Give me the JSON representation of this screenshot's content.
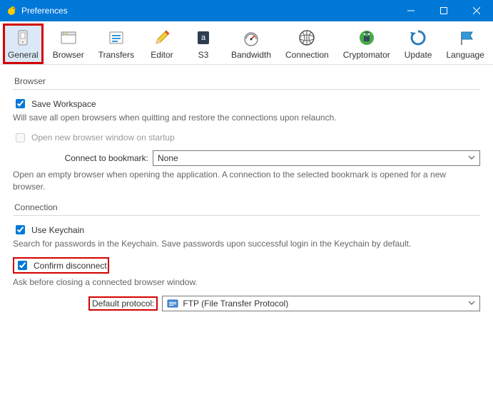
{
  "window": {
    "title": "Preferences"
  },
  "toolbar": {
    "items": [
      {
        "label": "General"
      },
      {
        "label": "Browser"
      },
      {
        "label": "Transfers"
      },
      {
        "label": "Editor"
      },
      {
        "label": "S3"
      },
      {
        "label": "Bandwidth"
      },
      {
        "label": "Connection"
      },
      {
        "label": "Cryptomator"
      },
      {
        "label": "Update"
      },
      {
        "label": "Language"
      }
    ]
  },
  "browser": {
    "group_label": "Browser",
    "save_workspace_label": "Save Workspace",
    "save_workspace_desc": "Will save all open browsers when quitting and restore the connections upon relaunch.",
    "open_new_window_label": "Open new browser window on startup",
    "connect_bookmark_label": "Connect to bookmark:",
    "connect_bookmark_value": "None",
    "connect_bookmark_desc": "Open an empty browser when opening the application. A connection to the selected bookmark is opened for a new browser."
  },
  "connection": {
    "group_label": "Connection",
    "use_keychain_label": "Use Keychain",
    "use_keychain_desc": "Search for passwords in the Keychain. Save passwords upon successful login in the Keychain by default.",
    "confirm_disconnect_label": "Confirm disconnect",
    "confirm_disconnect_desc": "Ask before closing a connected browser window.",
    "default_protocol_label": "Default protocol:",
    "default_protocol_value": "FTP (File Transfer Protocol)"
  }
}
